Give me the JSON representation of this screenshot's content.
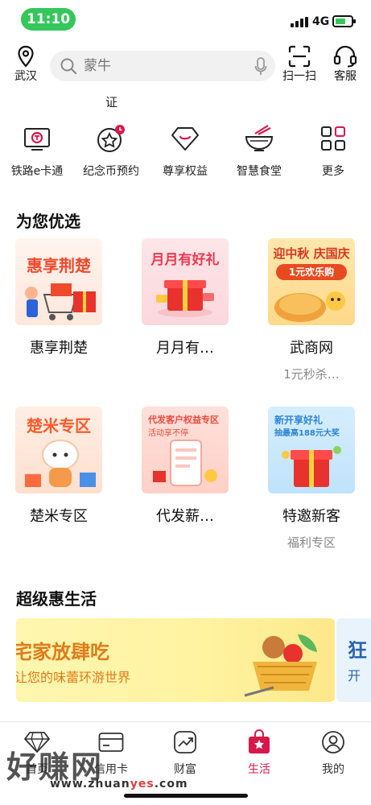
{
  "status_bar": {
    "time": "11:10",
    "network": "4G"
  },
  "header": {
    "location_label": "武汉",
    "search_placeholder": "蒙牛",
    "scan_label": "扫一扫",
    "service_label": "客服"
  },
  "cut_row": {
    "partial_text": "证"
  },
  "quick_services": [
    {
      "label": "铁路e卡通",
      "icon": "train-card-icon"
    },
    {
      "label": "纪念币预约",
      "icon": "coin-clock-icon"
    },
    {
      "label": "尊享权益",
      "icon": "diamond-icon"
    },
    {
      "label": "智慧食堂",
      "icon": "bowl-icon"
    },
    {
      "label": "更多",
      "icon": "grid-icon"
    }
  ],
  "recommend": {
    "title": "为您优选",
    "cards": [
      {
        "title": "惠享荆楚",
        "subtitle": "",
        "image_text": "惠享荆楚",
        "colors": [
          "#fff1ea",
          "#ff6b3d"
        ]
      },
      {
        "title": "月月有…",
        "subtitle": "",
        "image_text": "月月有好礼",
        "colors": [
          "#fde3e6",
          "#f0384f"
        ]
      },
      {
        "title": "武商网",
        "subtitle": "1元秒杀…",
        "image_text": "迎中秋 庆国庆",
        "image_text2": "1元欢乐购",
        "colors": [
          "#ffe3a4",
          "#e84a1f"
        ]
      },
      {
        "title": "楚米专区",
        "subtitle": "",
        "image_text": "楚米专区",
        "colors": [
          "#ffeadc",
          "#ff5a2a"
        ]
      },
      {
        "title": "代发薪…",
        "subtitle": "",
        "image_text": "代发客户权益专区",
        "image_text2": "活动享不停",
        "colors": [
          "#ffd9d2",
          "#e9493c"
        ]
      },
      {
        "title": "特邀新客",
        "subtitle": "福利专区",
        "image_text": "新开享好礼",
        "image_text2": "抽最高188元大奖",
        "colors": [
          "#cdeafd",
          "#2a84d8"
        ]
      }
    ]
  },
  "life": {
    "title": "超级惠生活",
    "banner_title": "宅家放肆吃",
    "banner_subtitle": "让您的味蕾环游世界",
    "banner2_title": "狂",
    "banner2_subtitle": "开"
  },
  "tabbar": {
    "items": [
      {
        "label": "首页",
        "icon": "diamond-home-icon",
        "active": false
      },
      {
        "label": "信用卡",
        "icon": "credit-card-icon",
        "active": false
      },
      {
        "label": "财富",
        "icon": "trend-chart-icon",
        "active": false
      },
      {
        "label": "生活",
        "icon": "shopping-bag-icon",
        "active": true
      },
      {
        "label": "我的",
        "icon": "person-icon",
        "active": false
      }
    ]
  },
  "watermark": {
    "logo_text": "好赚网",
    "url_prefix": "www.zhuan",
    "url_highlight": "yes",
    "url_suffix": ".com"
  },
  "colors": {
    "accent": "#d8174a",
    "status_green": "#34c759"
  }
}
